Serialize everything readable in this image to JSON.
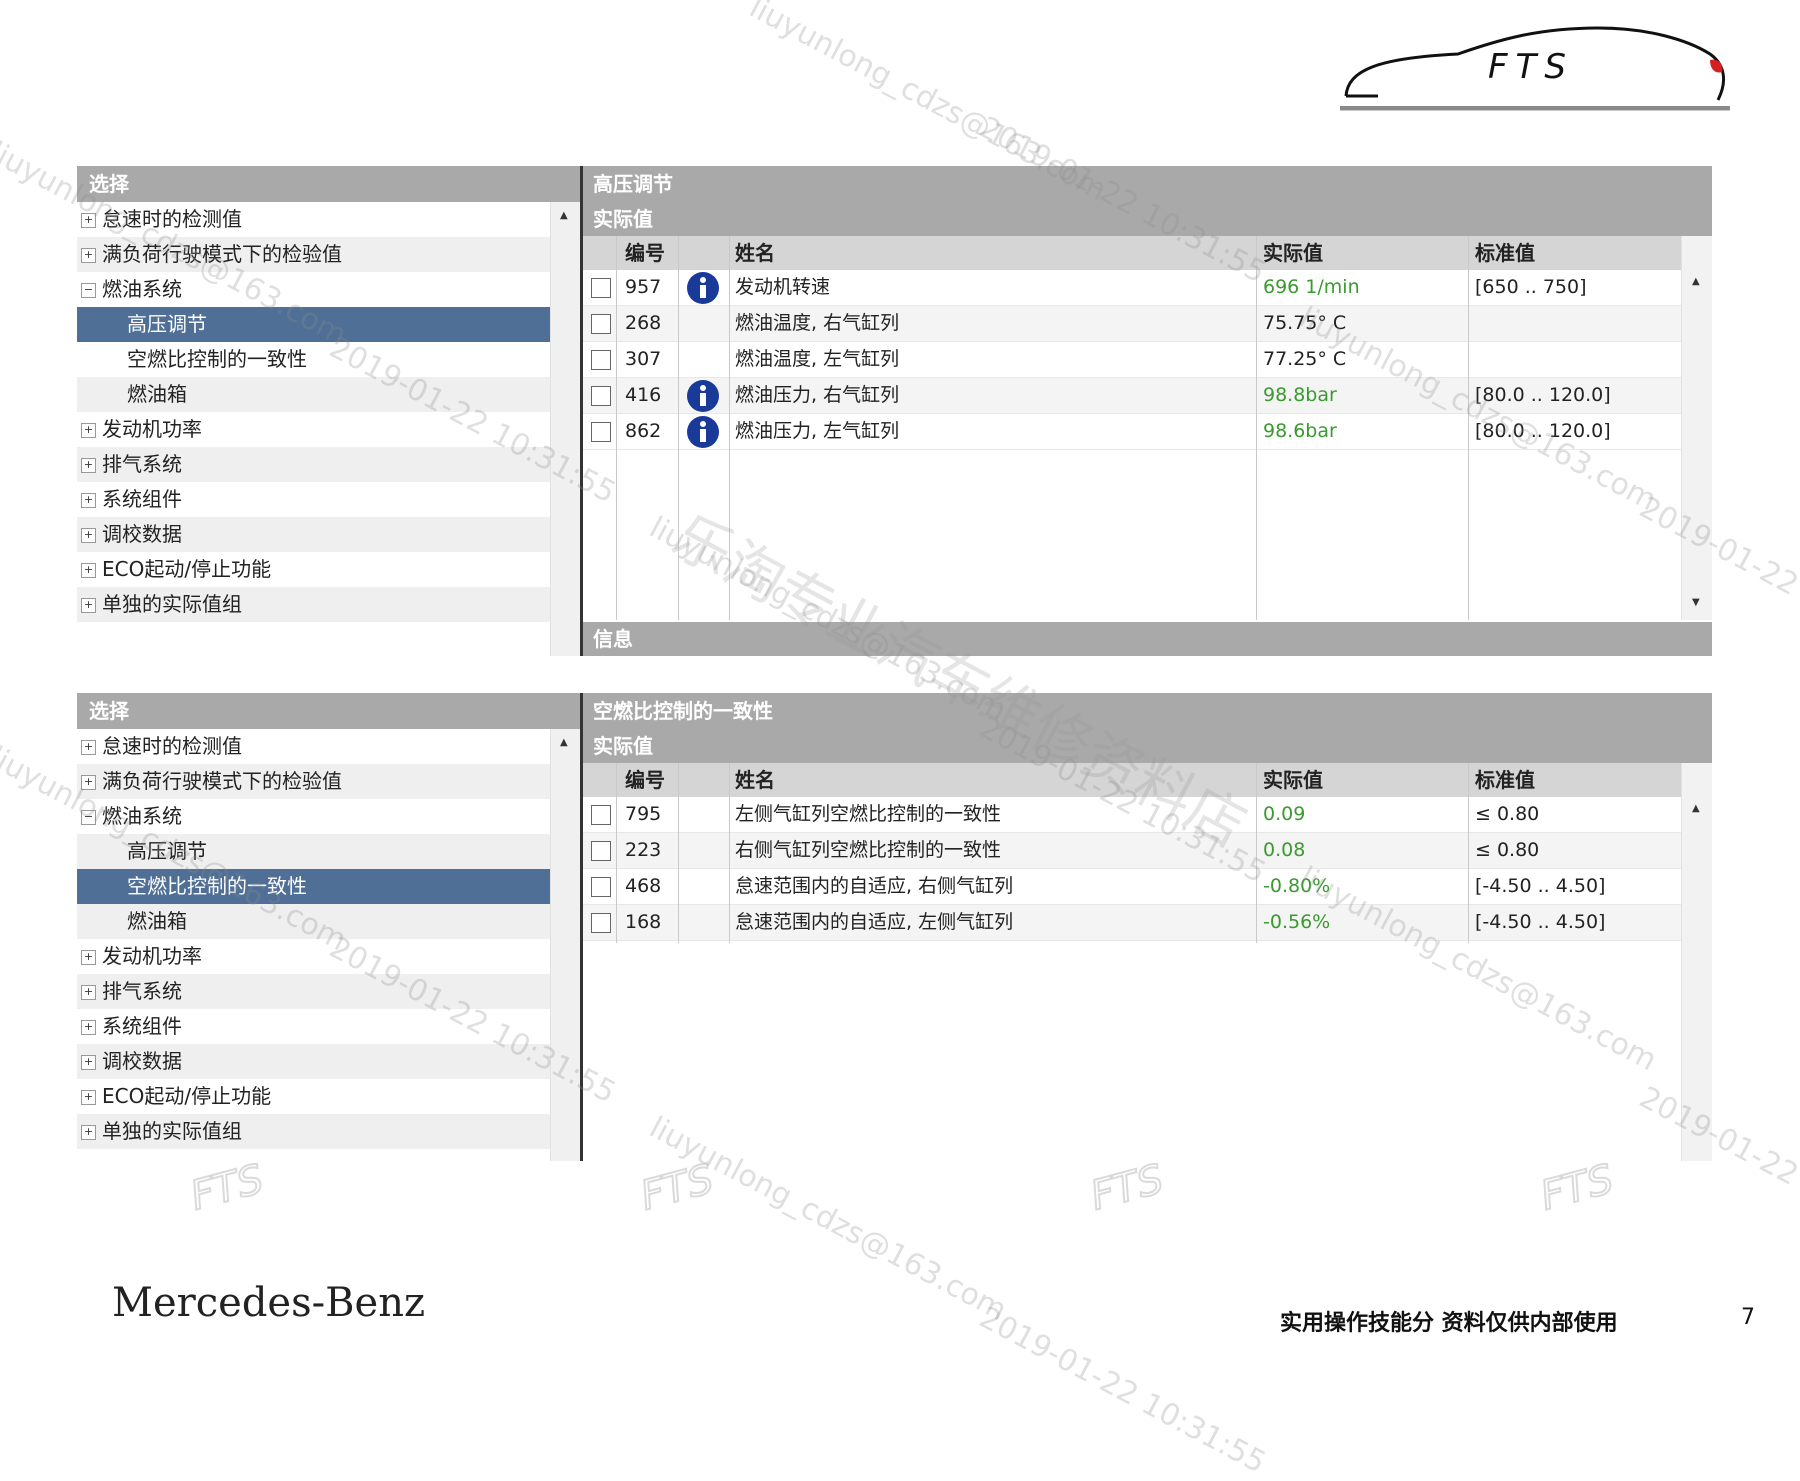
{
  "logo_text": "FTS",
  "panels": [
    {
      "select": {
        "header": "选择",
        "tree": [
          {
            "label": "怠速时的检测值",
            "sign": "+",
            "child": false,
            "selected": false
          },
          {
            "label": "满负荷行驶模式下的检验值",
            "sign": "+",
            "child": false,
            "selected": false
          },
          {
            "label": "燃油系统",
            "sign": "−",
            "child": false,
            "selected": false
          },
          {
            "label": "高压调节",
            "sign": "",
            "child": true,
            "selected": true
          },
          {
            "label": "空燃比控制的一致性",
            "sign": "",
            "child": true,
            "selected": false
          },
          {
            "label": "燃油箱",
            "sign": "",
            "child": true,
            "selected": false
          },
          {
            "label": "发动机功率",
            "sign": "+",
            "child": false,
            "selected": false
          },
          {
            "label": "排气系统",
            "sign": "+",
            "child": false,
            "selected": false
          },
          {
            "label": "系统组件",
            "sign": "+",
            "child": false,
            "selected": false
          },
          {
            "label": "调校数据",
            "sign": "+",
            "child": false,
            "selected": false
          },
          {
            "label": "ECO起动/停止功能",
            "sign": "+",
            "child": false,
            "selected": false
          },
          {
            "label": "单独的实际值组",
            "sign": "+",
            "child": false,
            "selected": false
          }
        ]
      },
      "right": {
        "title": "高压调节",
        "subtitle": "实际值",
        "columns": {
          "num": "编号",
          "name": "姓名",
          "val": "实际值",
          "std": "标准值"
        },
        "rows": [
          {
            "num": "957",
            "info": true,
            "name": "发动机转速",
            "val": "696 1/min",
            "val_green": true,
            "std": "[650 .. 750]"
          },
          {
            "num": "268",
            "info": false,
            "name": "燃油温度, 右气缸列",
            "val": "75.75° C",
            "val_green": false,
            "std": ""
          },
          {
            "num": "307",
            "info": false,
            "name": "燃油温度, 左气缸列",
            "val": "77.25° C",
            "val_green": false,
            "std": ""
          },
          {
            "num": "416",
            "info": true,
            "name": "燃油压力, 右气缸列",
            "val": "98.8bar",
            "val_green": true,
            "std": "[80.0 .. 120.0]"
          },
          {
            "num": "862",
            "info": true,
            "name": "燃油压力, 左气缸列",
            "val": "98.6bar",
            "val_green": true,
            "std": "[80.0 .. 120.0]"
          }
        ],
        "info_bar": "信息"
      }
    },
    {
      "select": {
        "header": "选择",
        "tree": [
          {
            "label": "怠速时的检测值",
            "sign": "+",
            "child": false,
            "selected": false
          },
          {
            "label": "满负荷行驶模式下的检验值",
            "sign": "+",
            "child": false,
            "selected": false
          },
          {
            "label": "燃油系统",
            "sign": "−",
            "child": false,
            "selected": false
          },
          {
            "label": "高压调节",
            "sign": "",
            "child": true,
            "selected": false
          },
          {
            "label": "空燃比控制的一致性",
            "sign": "",
            "child": true,
            "selected": true
          },
          {
            "label": "燃油箱",
            "sign": "",
            "child": true,
            "selected": false
          },
          {
            "label": "发动机功率",
            "sign": "+",
            "child": false,
            "selected": false
          },
          {
            "label": "排气系统",
            "sign": "+",
            "child": false,
            "selected": false
          },
          {
            "label": "系统组件",
            "sign": "+",
            "child": false,
            "selected": false
          },
          {
            "label": "调校数据",
            "sign": "+",
            "child": false,
            "selected": false
          },
          {
            "label": "ECO起动/停止功能",
            "sign": "+",
            "child": false,
            "selected": false
          },
          {
            "label": "单独的实际值组",
            "sign": "+",
            "child": false,
            "selected": false
          }
        ]
      },
      "right": {
        "title": "空燃比控制的一致性",
        "subtitle": "实际值",
        "columns": {
          "num": "编号",
          "name": "姓名",
          "val": "实际值",
          "std": "标准值"
        },
        "rows": [
          {
            "num": "795",
            "info": false,
            "name": "左侧气缸列空燃比控制的一致性",
            "val": "0.09",
            "val_green": true,
            "std": "≤ 0.80"
          },
          {
            "num": "223",
            "info": false,
            "name": "右侧气缸列空燃比控制的一致性",
            "val": "0.08",
            "val_green": true,
            "std": "≤ 0.80"
          },
          {
            "num": "468",
            "info": false,
            "name": "怠速范围内的自适应, 右侧气缸列",
            "val": "-0.80%",
            "val_green": true,
            "std": "[-4.50 .. 4.50]"
          },
          {
            "num": "168",
            "info": false,
            "name": "怠速范围内的自适应, 左侧气缸列",
            "val": "-0.56%",
            "val_green": true,
            "std": "[-4.50 .. 4.50]"
          }
        ],
        "info_bar": ""
      }
    }
  ],
  "footer": {
    "brand": "Mercedes-Benz",
    "note": "实用操作技能分 资料仅供内部使用",
    "page": "7"
  },
  "watermarks": {
    "email": "liuyunlong_cdzs@163.com",
    "date": "2019-01-22 10:31:55",
    "shop": "乐淘专业汽车维修资料店",
    "mark": "FTS"
  },
  "colors": {
    "header_gray": "#a9a9a9",
    "selected_blue": "#4f6f96",
    "value_green": "#3a9a2e"
  }
}
